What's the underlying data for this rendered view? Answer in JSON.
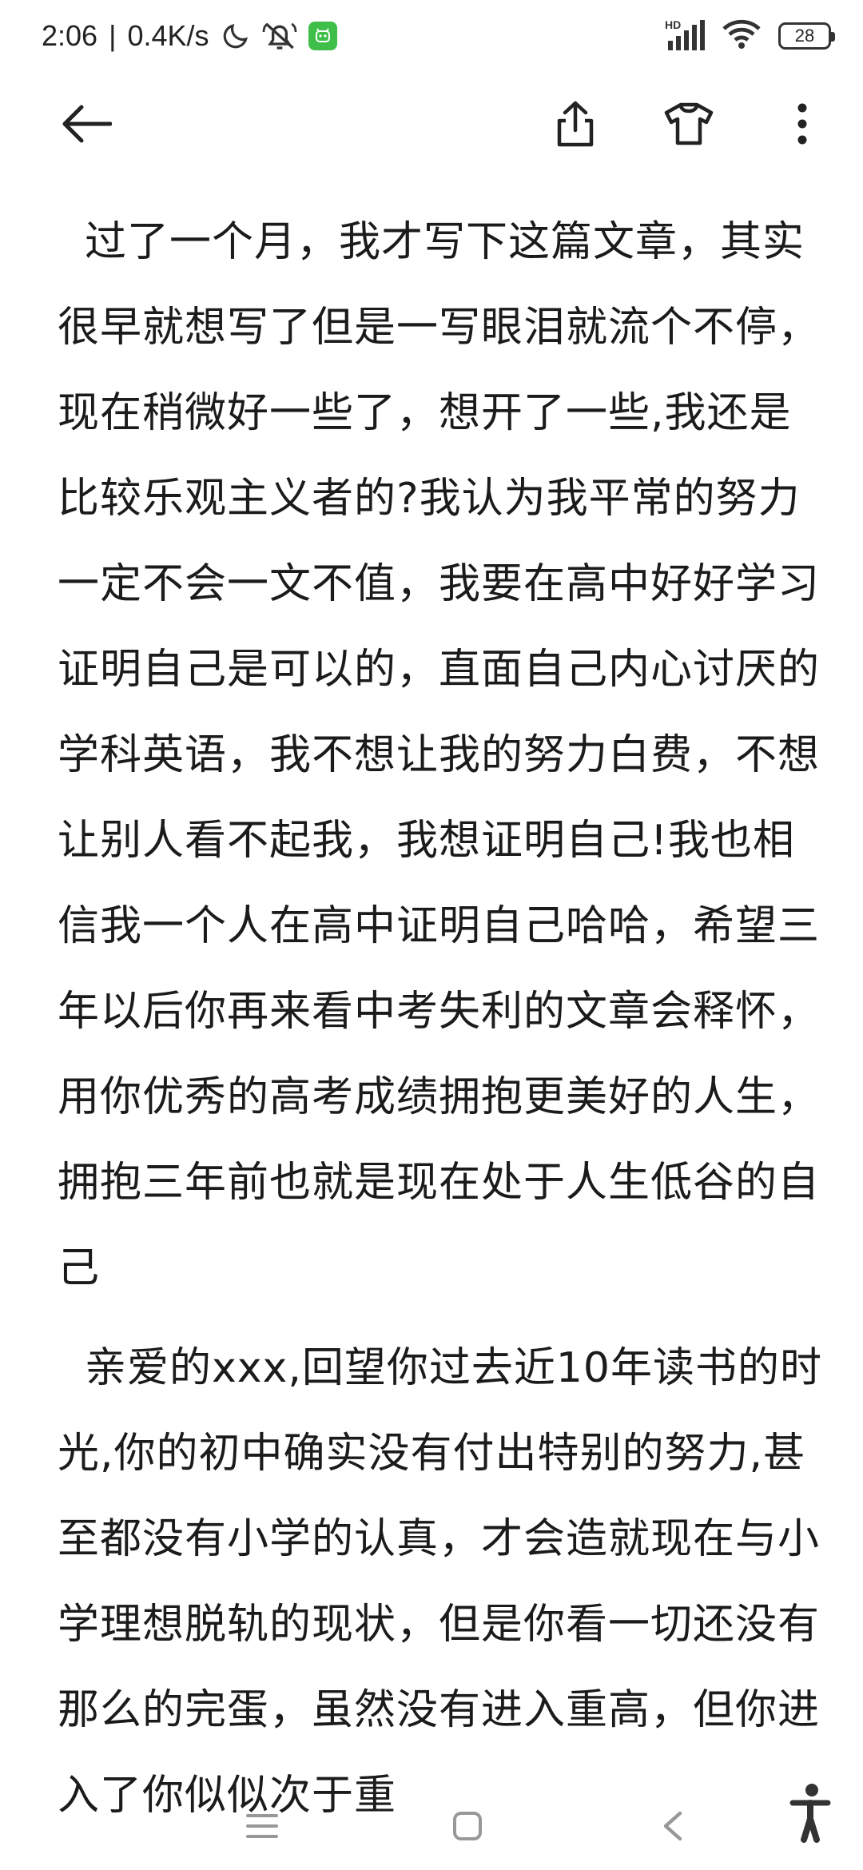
{
  "status_bar": {
    "time": "2:06",
    "separator": "|",
    "network_speed": "0.4K/s",
    "signal_label": "HD",
    "battery_level": "28",
    "icons": [
      "moon-icon",
      "notifications-muted-icon",
      "app-badge-icon",
      "signal-icon",
      "wifi-icon",
      "battery-icon"
    ],
    "accent_color": "#3fbf4a"
  },
  "toolbar": {
    "icons": [
      "back-arrow-icon",
      "share-icon",
      "theme-shirt-icon",
      "more-vertical-icon"
    ]
  },
  "article": {
    "paragraphs": [
      "过了一个月，我才写下这篇文章，其实很早就想写了但是一写眼泪就流个不停，现在稍微好一些了，想开了一些,我还是比较乐观主义者的?我认为我平常的努力一定不会一文不值，我要在高中好好学习证明自己是可以的，直面自己内心讨厌的学科英语，我不想让我的努力白费，不想让别人看不起我，我想证明自己!我也相信我一个人在高中证明自己哈哈，希望三年以后你再来看中考失利的文章会释怀，用你优秀的高考成绩拥抱更美好的人生，拥抱三年前也就是现在处于人生低谷的自己",
      "亲爱的xxx,回望你过去近10年读书的时光,你的初中确实没有付出特别的努力,甚至都没有小学的认真，才会造就现在与小学理想脱轨的现状，但是你看一切还没有那么的完蛋，虽然没有进入重高，但你进入了你似似次于重"
    ]
  },
  "nav_bar": {
    "icons": [
      "menu-icon",
      "home-square-icon",
      "back-chevron-icon",
      "accessibility-icon"
    ]
  }
}
